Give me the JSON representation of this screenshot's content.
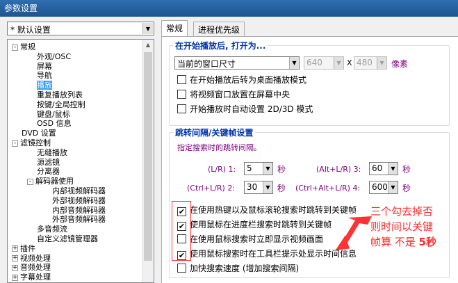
{
  "window": {
    "title": "参数设置"
  },
  "preset": {
    "value": "* 默认设置"
  },
  "tree": {
    "items": [
      {
        "label": "常规",
        "expander": "-",
        "level": 0
      },
      {
        "label": "外观/OSC",
        "level": 1
      },
      {
        "label": "屏幕",
        "level": 1
      },
      {
        "label": "导航",
        "level": 1
      },
      {
        "label": "播放",
        "level": 1,
        "selected": true
      },
      {
        "label": "重复播放列表",
        "level": 1
      },
      {
        "label": "按键/全局控制",
        "level": 1
      },
      {
        "label": "键盘/鼠标",
        "level": 1
      },
      {
        "label": "OSD 信息",
        "level": 1
      },
      {
        "label": "DVD 设置",
        "level": 0
      },
      {
        "label": "滤镜控制",
        "expander": "-",
        "level": 0
      },
      {
        "label": "无缝播放",
        "level": 1
      },
      {
        "label": "源滤镜",
        "level": 1
      },
      {
        "label": "分离器",
        "level": 1
      },
      {
        "label": "解码器使用",
        "expander": "-",
        "level": 1
      },
      {
        "label": "内部视频解码器",
        "level": 2
      },
      {
        "label": "外部视频解码器",
        "level": 2
      },
      {
        "label": "内部音频解码器",
        "level": 2
      },
      {
        "label": "外部音频解码器",
        "level": 2
      },
      {
        "label": "多音频流",
        "level": 1
      },
      {
        "label": "自定义滤镜管理器",
        "level": 1
      },
      {
        "label": "插件",
        "expander": "+",
        "level": 0
      },
      {
        "label": "视频处理",
        "expander": "+",
        "level": 0
      },
      {
        "label": "音频处理",
        "expander": "+",
        "level": 0
      },
      {
        "label": "字幕处理",
        "expander": "+",
        "level": 0
      }
    ]
  },
  "tabs": [
    {
      "label": "常规",
      "active": true
    },
    {
      "label": "进程优先级",
      "active": false
    }
  ],
  "open_group": {
    "title": "在开始播放后, 打开为...",
    "size_select": "当前的窗口尺寸",
    "width": "640",
    "x_label": "X",
    "height": "480",
    "unit": "像素",
    "options": [
      {
        "label": "在开始播放后转为桌面播放模式",
        "checked": false
      },
      {
        "label": "将视频窗口放置在屏幕中央",
        "checked": false
      },
      {
        "label": "开始播放时自动设置 2D/3D 模式",
        "checked": false
      }
    ]
  },
  "jump_group": {
    "title": "跳转间隔/关键帧设置",
    "hint": "指定搜索时的跳转间隔。",
    "fields": [
      {
        "label": "(L/R) 1:",
        "value": "5",
        "unit": "秒"
      },
      {
        "label": "(Alt+L/R) 3:",
        "value": "60",
        "unit": "秒"
      },
      {
        "label": "(Ctrl+L/R) 2:",
        "value": "30",
        "unit": "秒"
      },
      {
        "label": "(Ctrl+Alt+L/R) 4:",
        "value": "600",
        "unit": "秒"
      }
    ],
    "options": [
      {
        "label": "在使用热键以及鼠标滚轮搜索时跳转到关键帧",
        "checked": true
      },
      {
        "label": "使用鼠标在进度栏搜索时跳转到关键帧",
        "checked": true
      },
      {
        "label": "在使用鼠标搜索时立即显示视频画面",
        "checked": false
      },
      {
        "label": "使用鼠标搜索时在工具栏提示处显示时间信息",
        "checked": true
      },
      {
        "label": "加快搜索速度 (增加搜索间隔)",
        "checked": false
      }
    ]
  },
  "annotation": {
    "line1": "三个勾去掉否",
    "line2": "则时间以关键",
    "line3_a": "帧算  不是 ",
    "line3_b": "5秒",
    "color": "#ff2a2a"
  }
}
